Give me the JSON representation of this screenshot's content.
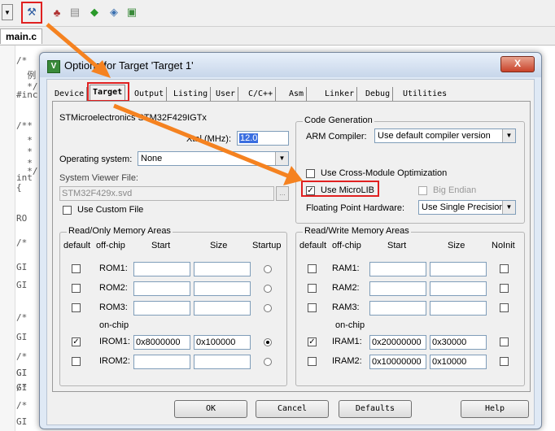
{
  "toolbar": {
    "icons": [
      "dropdown-arrow-icon",
      "target-options-icon",
      "component-icon",
      "stack-icon",
      "diamond-icon",
      "pack-installer-icon",
      "book-icon"
    ]
  },
  "editor": {
    "file_tab": "main.c",
    "code_lines": [
      "/*",
      "  例",
      "  */",
      "#inc",
      "/**",
      "  *",
      "  *",
      "  *",
      "  */",
      "int",
      "{",
      "RO",
      "/*",
      "GI",
      "GI",
      "/*",
      "GI",
      "/*",
      "GI",
      "/*",
      "GI",
      "GI",
      "/*",
      "GI"
    ]
  },
  "dialog": {
    "title": "Options for Target 'Target 1'",
    "close_label": "X",
    "tabs": [
      "Device",
      "Target",
      "Output",
      "Listing",
      "User",
      "C/C++",
      "Asm",
      "Linker",
      "Debug",
      "Utilities"
    ],
    "active_tab": "Target",
    "device_name": "STMicroelectronics STM32F429IGTx",
    "xtal_label": "Xtal (MHz):",
    "xtal_value": "12.0",
    "os_label": "Operating system:",
    "os_value": "None",
    "svf_label": "System Viewer File:",
    "svf_value": "STM32F429x.svd",
    "svf_browse": "...",
    "use_custom_file": "Use Custom File",
    "code_gen": {
      "title": "Code Generation",
      "compiler_label": "ARM Compiler:",
      "compiler_value": "Use default compiler version",
      "cross_module": "Use Cross-Module Optimization",
      "microlib": "Use MicroLIB",
      "big_endian": "Big Endian",
      "fp_label": "Floating Point Hardware:",
      "fp_value": "Use Single Precision"
    },
    "ro": {
      "title": "Read/Only Memory Areas",
      "headers": [
        "default",
        "off-chip",
        "Start",
        "Size",
        "Startup"
      ],
      "onchip_label": "on-chip",
      "rows": [
        {
          "name": "ROM1:",
          "start": "",
          "size": "",
          "default": false,
          "startup": false
        },
        {
          "name": "ROM2:",
          "start": "",
          "size": "",
          "default": false,
          "startup": false
        },
        {
          "name": "ROM3:",
          "start": "",
          "size": "",
          "default": false,
          "startup": false
        },
        {
          "name": "IROM1:",
          "start": "0x8000000",
          "size": "0x100000",
          "default": true,
          "startup": true
        },
        {
          "name": "IROM2:",
          "start": "",
          "size": "",
          "default": false,
          "startup": false
        }
      ]
    },
    "rw": {
      "title": "Read/Write Memory Areas",
      "headers": [
        "default",
        "off-chip",
        "Start",
        "Size",
        "NoInit"
      ],
      "onchip_label": "on-chip",
      "rows": [
        {
          "name": "RAM1:",
          "start": "",
          "size": "",
          "default": false
        },
        {
          "name": "RAM2:",
          "start": "",
          "size": "",
          "default": false
        },
        {
          "name": "RAM3:",
          "start": "",
          "size": "",
          "default": false
        },
        {
          "name": "IRAM1:",
          "start": "0x20000000",
          "size": "0x30000",
          "default": true
        },
        {
          "name": "IRAM2:",
          "start": "0x10000000",
          "size": "0x10000",
          "default": false
        }
      ]
    },
    "buttons": {
      "ok": "OK",
      "cancel": "Cancel",
      "defaults": "Defaults",
      "help": "Help"
    }
  },
  "colors": {
    "highlight": "#e02020",
    "arrow": "#f58220",
    "title_icon": "#3a8a3a"
  }
}
